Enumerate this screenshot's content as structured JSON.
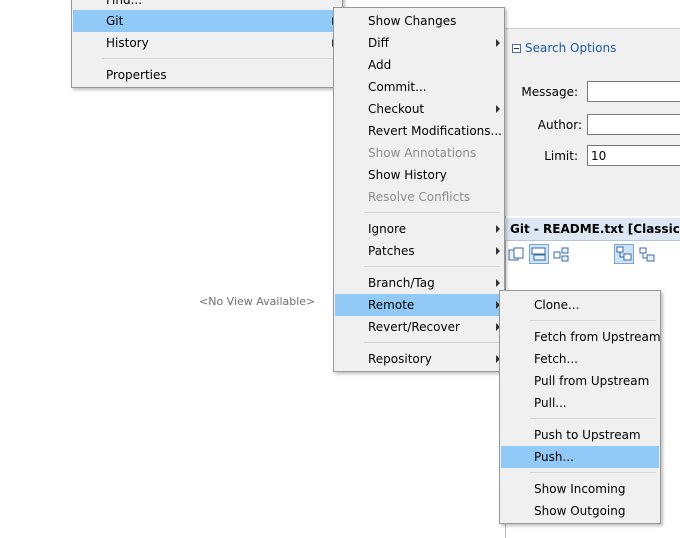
{
  "background": {
    "no_view_label": "<No View Available>"
  },
  "menu1": {
    "items": [
      {
        "label": "Find...",
        "selected": false,
        "submenu": false
      },
      {
        "label": "Git",
        "selected": true,
        "submenu": true
      },
      {
        "label": "History",
        "selected": false,
        "submenu": true
      },
      {
        "label": "Properties",
        "selected": false,
        "submenu": false
      }
    ]
  },
  "menu2": {
    "items": [
      {
        "label": "Show Changes"
      },
      {
        "label": "Diff",
        "submenu": true
      },
      {
        "label": "Add"
      },
      {
        "label": "Commit..."
      },
      {
        "label": "Checkout",
        "submenu": true
      },
      {
        "label": "Revert Modifications..."
      },
      {
        "label": "Show Annotations",
        "disabled": true
      },
      {
        "label": "Show History"
      },
      {
        "label": "Resolve Conflicts",
        "disabled": true
      },
      {
        "label": "Ignore",
        "submenu": true
      },
      {
        "label": "Patches",
        "submenu": true
      },
      {
        "label": "Branch/Tag",
        "submenu": true
      },
      {
        "label": "Remote",
        "submenu": true,
        "selected": true
      },
      {
        "label": "Revert/Recover",
        "submenu": true
      },
      {
        "label": "Repository",
        "submenu": true
      }
    ]
  },
  "menu3": {
    "items": [
      {
        "label": "Clone..."
      },
      {
        "label": "Fetch from Upstream"
      },
      {
        "label": "Fetch..."
      },
      {
        "label": "Pull from Upstream"
      },
      {
        "label": "Pull..."
      },
      {
        "label": "Push to Upstream"
      },
      {
        "label": "Push...",
        "selected": true
      },
      {
        "label": "Show Incoming"
      },
      {
        "label": "Show Outgoing"
      }
    ]
  },
  "search_panel": {
    "toggle_label": "Search Options",
    "message_label": "Message:",
    "message_value": "",
    "author_label": "Author:",
    "author_value": "",
    "limit_label": "Limit:",
    "limit_value": "10"
  },
  "git_panel": {
    "title": "Git - README.txt [Classic.X] - r",
    "toolbar_icons": [
      "git-diff-icon",
      "git-history-icon",
      "git-graph-icon",
      "git-tree-icon",
      "git-flat-list-icon"
    ]
  },
  "colors": {
    "selection": "#91c9f7",
    "menu_bg": "#f0f0f0",
    "accent_link": "#1e5aa8"
  }
}
